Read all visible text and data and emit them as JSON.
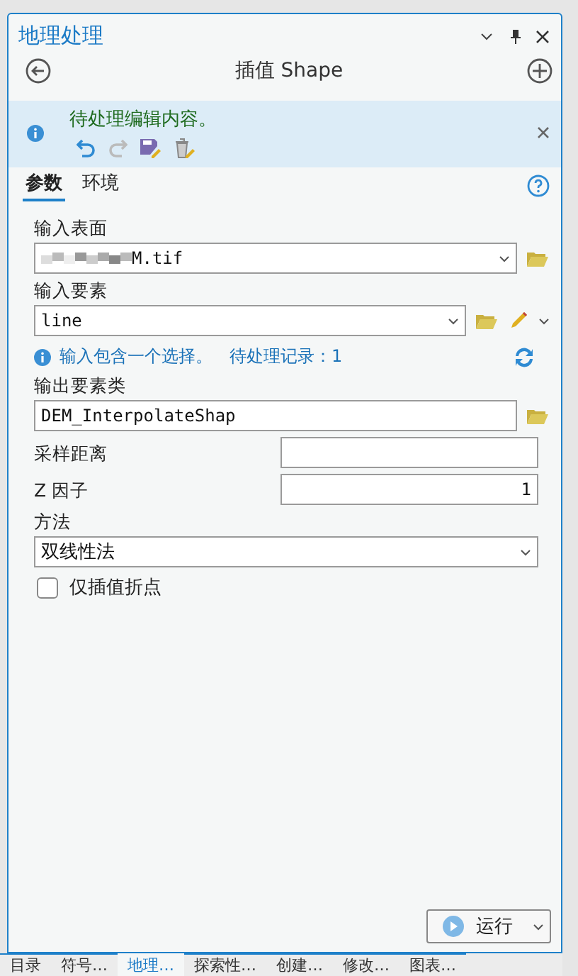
{
  "window": {
    "title": "地理处理"
  },
  "tool": {
    "title": "插值 Shape"
  },
  "banner": {
    "message": "待处理编辑内容。"
  },
  "tabs": [
    {
      "label": "参数",
      "selected": true
    },
    {
      "label": "环境",
      "selected": false
    }
  ],
  "params": [
    {
      "kind": "combo",
      "label": "输入表面",
      "value": "M.tif",
      "masked": true
    },
    {
      "kind": "combo-edit",
      "label": "输入要素",
      "value": "line"
    },
    {
      "kind": "note",
      "text": "输入包含一个选择。",
      "extra": "待处理记录：1"
    },
    {
      "kind": "text",
      "label": "输出要素类",
      "value": "DEM_InterpolateShap"
    },
    {
      "kind": "inline",
      "label": "采样距离"
    },
    {
      "kind": "inline",
      "label": "Z 因子",
      "value": "1"
    },
    {
      "kind": "select",
      "label": "方法",
      "value": "双线性法"
    },
    {
      "kind": "checkbox",
      "label": "仅插值折点",
      "checked": false
    }
  ],
  "run_button": {
    "label": "运行"
  },
  "dock_tabs": [
    {
      "label": "目录",
      "selected": false
    },
    {
      "label": "符号…",
      "selected": false
    },
    {
      "label": "地理…",
      "selected": true
    },
    {
      "label": "探索性…",
      "selected": false
    },
    {
      "label": "创建…",
      "selected": false
    },
    {
      "label": "修改…",
      "selected": false
    },
    {
      "label": "图表…",
      "selected": false
    }
  ]
}
